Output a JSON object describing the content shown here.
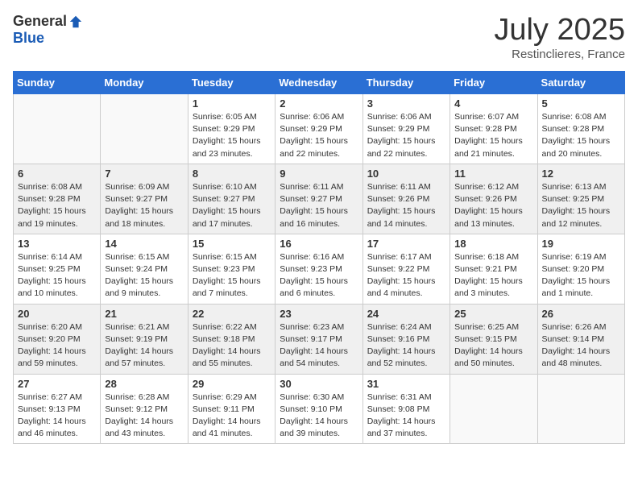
{
  "header": {
    "logo_general": "General",
    "logo_blue": "Blue",
    "month_title": "July 2025",
    "location": "Restinclieres, France"
  },
  "weekdays": [
    "Sunday",
    "Monday",
    "Tuesday",
    "Wednesday",
    "Thursday",
    "Friday",
    "Saturday"
  ],
  "weeks": [
    [
      {
        "day": "",
        "info": ""
      },
      {
        "day": "",
        "info": ""
      },
      {
        "day": "1",
        "info": "Sunrise: 6:05 AM\nSunset: 9:29 PM\nDaylight: 15 hours\nand 23 minutes."
      },
      {
        "day": "2",
        "info": "Sunrise: 6:06 AM\nSunset: 9:29 PM\nDaylight: 15 hours\nand 22 minutes."
      },
      {
        "day": "3",
        "info": "Sunrise: 6:06 AM\nSunset: 9:29 PM\nDaylight: 15 hours\nand 22 minutes."
      },
      {
        "day": "4",
        "info": "Sunrise: 6:07 AM\nSunset: 9:28 PM\nDaylight: 15 hours\nand 21 minutes."
      },
      {
        "day": "5",
        "info": "Sunrise: 6:08 AM\nSunset: 9:28 PM\nDaylight: 15 hours\nand 20 minutes."
      }
    ],
    [
      {
        "day": "6",
        "info": "Sunrise: 6:08 AM\nSunset: 9:28 PM\nDaylight: 15 hours\nand 19 minutes."
      },
      {
        "day": "7",
        "info": "Sunrise: 6:09 AM\nSunset: 9:27 PM\nDaylight: 15 hours\nand 18 minutes."
      },
      {
        "day": "8",
        "info": "Sunrise: 6:10 AM\nSunset: 9:27 PM\nDaylight: 15 hours\nand 17 minutes."
      },
      {
        "day": "9",
        "info": "Sunrise: 6:11 AM\nSunset: 9:27 PM\nDaylight: 15 hours\nand 16 minutes."
      },
      {
        "day": "10",
        "info": "Sunrise: 6:11 AM\nSunset: 9:26 PM\nDaylight: 15 hours\nand 14 minutes."
      },
      {
        "day": "11",
        "info": "Sunrise: 6:12 AM\nSunset: 9:26 PM\nDaylight: 15 hours\nand 13 minutes."
      },
      {
        "day": "12",
        "info": "Sunrise: 6:13 AM\nSunset: 9:25 PM\nDaylight: 15 hours\nand 12 minutes."
      }
    ],
    [
      {
        "day": "13",
        "info": "Sunrise: 6:14 AM\nSunset: 9:25 PM\nDaylight: 15 hours\nand 10 minutes."
      },
      {
        "day": "14",
        "info": "Sunrise: 6:15 AM\nSunset: 9:24 PM\nDaylight: 15 hours\nand 9 minutes."
      },
      {
        "day": "15",
        "info": "Sunrise: 6:15 AM\nSunset: 9:23 PM\nDaylight: 15 hours\nand 7 minutes."
      },
      {
        "day": "16",
        "info": "Sunrise: 6:16 AM\nSunset: 9:23 PM\nDaylight: 15 hours\nand 6 minutes."
      },
      {
        "day": "17",
        "info": "Sunrise: 6:17 AM\nSunset: 9:22 PM\nDaylight: 15 hours\nand 4 minutes."
      },
      {
        "day": "18",
        "info": "Sunrise: 6:18 AM\nSunset: 9:21 PM\nDaylight: 15 hours\nand 3 minutes."
      },
      {
        "day": "19",
        "info": "Sunrise: 6:19 AM\nSunset: 9:20 PM\nDaylight: 15 hours\nand 1 minute."
      }
    ],
    [
      {
        "day": "20",
        "info": "Sunrise: 6:20 AM\nSunset: 9:20 PM\nDaylight: 14 hours\nand 59 minutes."
      },
      {
        "day": "21",
        "info": "Sunrise: 6:21 AM\nSunset: 9:19 PM\nDaylight: 14 hours\nand 57 minutes."
      },
      {
        "day": "22",
        "info": "Sunrise: 6:22 AM\nSunset: 9:18 PM\nDaylight: 14 hours\nand 55 minutes."
      },
      {
        "day": "23",
        "info": "Sunrise: 6:23 AM\nSunset: 9:17 PM\nDaylight: 14 hours\nand 54 minutes."
      },
      {
        "day": "24",
        "info": "Sunrise: 6:24 AM\nSunset: 9:16 PM\nDaylight: 14 hours\nand 52 minutes."
      },
      {
        "day": "25",
        "info": "Sunrise: 6:25 AM\nSunset: 9:15 PM\nDaylight: 14 hours\nand 50 minutes."
      },
      {
        "day": "26",
        "info": "Sunrise: 6:26 AM\nSunset: 9:14 PM\nDaylight: 14 hours\nand 48 minutes."
      }
    ],
    [
      {
        "day": "27",
        "info": "Sunrise: 6:27 AM\nSunset: 9:13 PM\nDaylight: 14 hours\nand 46 minutes."
      },
      {
        "day": "28",
        "info": "Sunrise: 6:28 AM\nSunset: 9:12 PM\nDaylight: 14 hours\nand 43 minutes."
      },
      {
        "day": "29",
        "info": "Sunrise: 6:29 AM\nSunset: 9:11 PM\nDaylight: 14 hours\nand 41 minutes."
      },
      {
        "day": "30",
        "info": "Sunrise: 6:30 AM\nSunset: 9:10 PM\nDaylight: 14 hours\nand 39 minutes."
      },
      {
        "day": "31",
        "info": "Sunrise: 6:31 AM\nSunset: 9:08 PM\nDaylight: 14 hours\nand 37 minutes."
      },
      {
        "day": "",
        "info": ""
      },
      {
        "day": "",
        "info": ""
      }
    ]
  ]
}
